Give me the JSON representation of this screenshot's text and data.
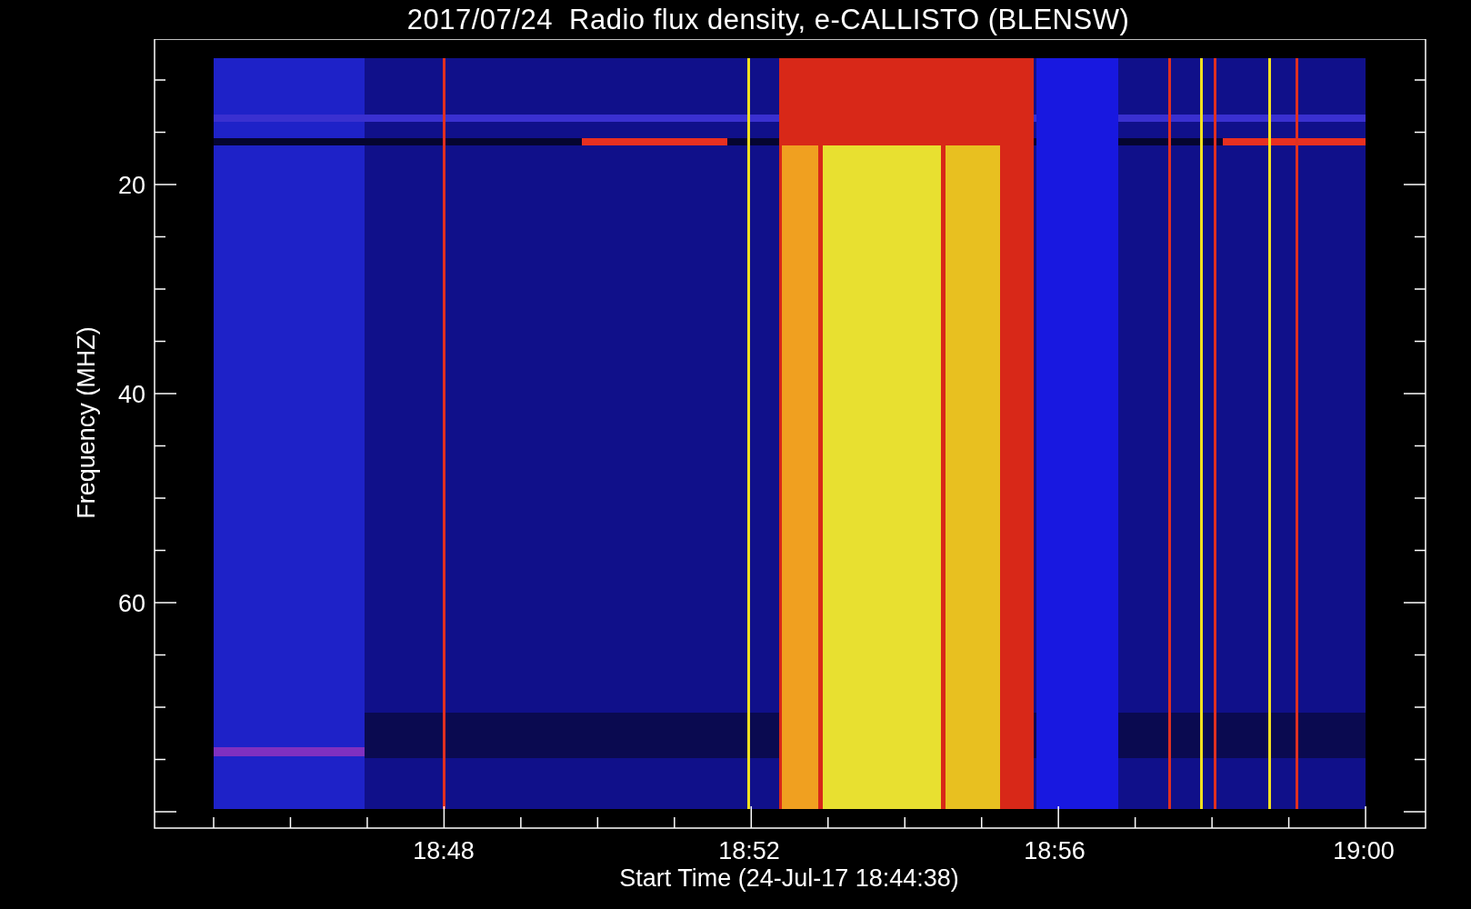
{
  "title": "2017/07/24  Radio flux density, e-CALLISTO (BLENSW)",
  "y_axis": {
    "label": "Frequency (MHZ)",
    "ticks": [
      "20",
      "40",
      "60"
    ]
  },
  "x_axis": {
    "label": "Start Time (24-Jul-17 18:44:38)",
    "ticks": [
      "18:48",
      "18:52",
      "18:56",
      "19:00"
    ]
  }
}
